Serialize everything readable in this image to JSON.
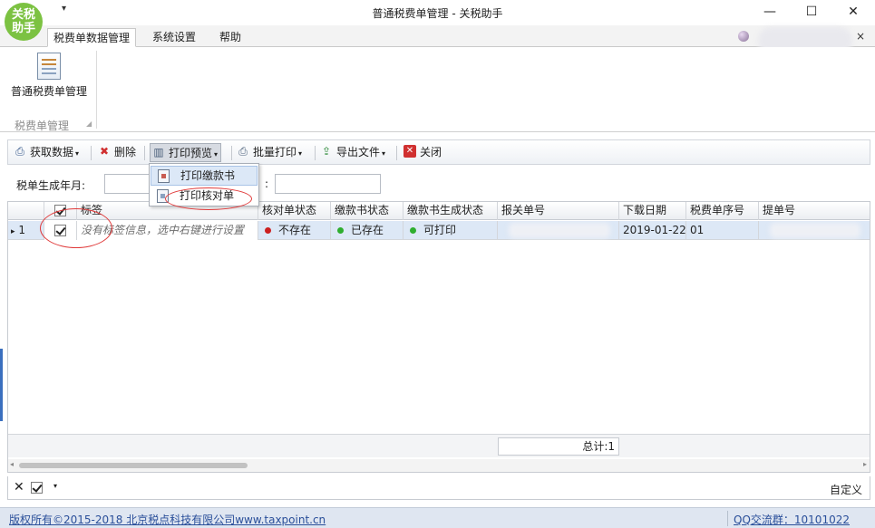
{
  "app": {
    "logo_line1": "关税",
    "logo_line2": "助手",
    "window_title": "普通税费单管理 - 关税助手",
    "quick_access": "▾",
    "win_min": "—",
    "win_max": "☐",
    "win_close": "✕"
  },
  "tabs": [
    {
      "label": "税费单数据管理",
      "active": true
    },
    {
      "label": "系统设置",
      "active": false
    },
    {
      "label": "帮助",
      "active": false
    }
  ],
  "tab_close": "×",
  "ribbon": {
    "button_label": "普通税费单管理",
    "group_label": "税费单管理",
    "group_arrow": "◢"
  },
  "toolbar": {
    "fetch": "获取数据",
    "delete": "删除",
    "print_preview": "打印预览",
    "batch_print": "批量打印",
    "export": "导出文件",
    "close": "关闭",
    "dropdown_arrow": "▾"
  },
  "print_menu": {
    "items": [
      "打印缴款书",
      "打印核对单"
    ]
  },
  "filter": {
    "label": "税单生成年月:",
    "colon": ":",
    "value_1": "",
    "value_2": ""
  },
  "grid": {
    "columns": [
      "标签",
      "核对单状态",
      "缴款书状态",
      "缴款书生成状态",
      "报关单号",
      "下载日期",
      "税费单序号",
      "提单号"
    ],
    "rows": [
      {
        "indicator": "▸",
        "row_no": "1",
        "tag": "没有标签信息，选中右键进行设置",
        "check_status": "不存在",
        "payment_status": "已存在",
        "gen_status": "可打印",
        "download_date": "2019-01-22",
        "seq": "01"
      }
    ],
    "total": "总计:1"
  },
  "filter_bar": {
    "clear": "✕",
    "dropdown": "▾",
    "custom": "自定义"
  },
  "status": {
    "copyright": "版权所有©2015-2018 北京税点科技有限公司www.taxpoint.cn",
    "qq": "QQ交流群：10101022"
  },
  "colors": {
    "logo_green": "#7cc242",
    "status_red": "#cc1f1f",
    "status_green": "#2fae2f",
    "row_selected": "#dde8f6",
    "annotation_red": "#e03a3a",
    "link_blue": "#2a4f9a"
  },
  "icons": {
    "fetch": "fetch-data-icon",
    "delete": "delete-icon",
    "print_preview": "print-preview-icon",
    "batch_print": "printer-icon",
    "export": "export-file-icon",
    "close": "close-icon"
  }
}
